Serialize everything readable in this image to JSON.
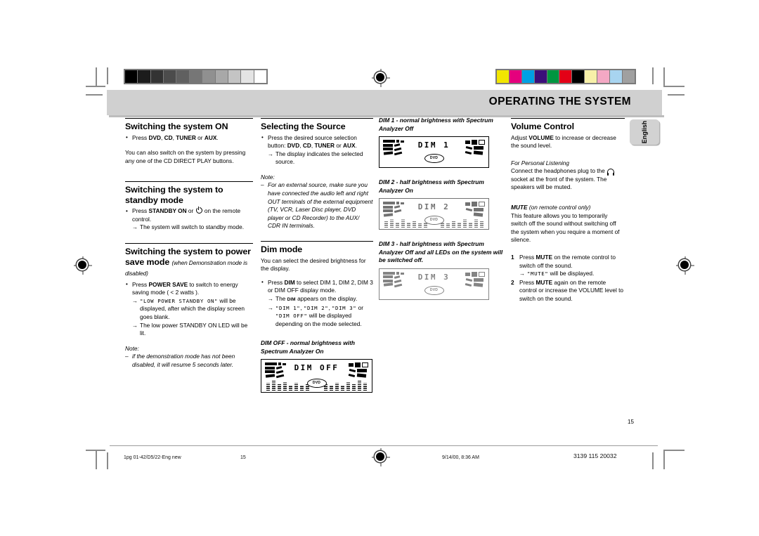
{
  "header": {
    "title": "OPERATING THE SYSTEM",
    "lang_tab": "English"
  },
  "calibration": {
    "gray_bar": [
      "#000000",
      "#1c1c1c",
      "#333333",
      "#4c4c4c",
      "#606060",
      "#767676",
      "#909090",
      "#a8a8a8",
      "#c4c4c4",
      "#e4e4e4",
      "#ffffff"
    ],
    "color_bar": [
      "#f2e600",
      "#e5007d",
      "#00a0e4",
      "#3b0f7a",
      "#009640",
      "#e30016",
      "#000000",
      "#f7f0a8",
      "#f4a8c4",
      "#a8d4f0",
      "#a0a0a0"
    ]
  },
  "col1": {
    "s1_title": "Switching the system ON",
    "s1_bullet": "Press DVD, CD, TUNER or AUX.",
    "s1_bullet_parts": {
      "pre": "Press ",
      "b1": "DVD",
      "sep1": ", ",
      "b2": "CD",
      "sep2": ", ",
      "b3": "TUNER",
      "sep3": " or ",
      "b4": "AUX",
      "post": "."
    },
    "s1_para": "You can also switch on the system by pressing any one of the CD DIRECT PLAY buttons.",
    "s2_title": "Switching the system to standby mode",
    "s2_bullet_pre": "Press ",
    "s2_bullet_b": "STANDBY ON",
    "s2_bullet_mid": " or ",
    "s2_bullet_post": " on the remote control.",
    "s2_arrow": "The system will switch to standby mode.",
    "s3_title_main": "Switching the system to power save mode",
    "s3_title_italic": "(when Demonstration mode is disabled)",
    "s3_bullet_pre": "Press ",
    "s3_bullet_b": "POWER SAVE",
    "s3_bullet_post": " to switch to energy saving mode ( < 2 watts ).",
    "s3_arrow1_lcd": "\"LOW POWER STANDBY ON\"",
    "s3_arrow1_rest": " will be displayed, after which the display screen goes blank.",
    "s3_arrow2": "The low power STANDBY ON LED will be lit.",
    "note_label": "Note:",
    "note_text": "if the demonstration mode has not been disabled, it will resume 5 seconds later."
  },
  "col2": {
    "s1_title": "Selecting the Source",
    "s1_bullet_pre": "Press the desired source selection button: ",
    "s1_b1": "DVD",
    "s1_sep1": ", ",
    "s1_b2": "CD",
    "s1_sep2": ", ",
    "s1_b3": "TUNER",
    "s1_sep3": " or ",
    "s1_b4": "AUX",
    "s1_post": ".",
    "s1_arrow": "The display indicates the selected source.",
    "note_label": "Note:",
    "note_text": "For an external source, make sure you have connected the audio left and right OUT terminals of the external equipment (TV, VCR, Laser Disc player, DVD player or CD Recorder) to the AUX/ CDR IN terminals.",
    "s2_title": "Dim mode",
    "s2_para": "You can select the desired brightness for the display.",
    "s2_bullet_pre": "Press ",
    "s2_bullet_b": "DIM",
    "s2_bullet_post": " to select DIM 1, DIM 2, DIM 3 or DIM OFF display mode.",
    "s2_arrow1_pre": "The ",
    "s2_arrow1_caps": "DIM",
    "s2_arrow1_post": " appears on the display.",
    "s2_arrow2_lcd1": "\"DIM 1\"",
    "s2_arrow2_c1": ", ",
    "s2_arrow2_lcd2": "\"DIM 2\"",
    "s2_arrow2_c2": ", ",
    "s2_arrow2_lcd3": "\"DIM 3\"",
    "s2_arrow2_or": " or ",
    "s2_arrow2_lcd4": "\"DIM OFF\"",
    "s2_arrow2_rest": " will be displayed depending on the mode selected.",
    "caption_dimoff": "DIM OFF - normal brightness with Spectrum Analyzer On",
    "lcd_dimoff_text": "DIM OFF"
  },
  "col3": {
    "caption_dim1": "DIM 1 - normal brightness with Spectrum Analyzer Off",
    "lcd_dim1_text": "DIM 1",
    "caption_dim2": "DIM 2 - half brightness with Spectrum Analyzer On",
    "lcd_dim2_text": "DIM 2",
    "caption_dim3": "DIM 3 - half brightness with Spectrum Analyzer Off and all LEDs on the system will be switched off.",
    "lcd_dim3_text": "DIM 3"
  },
  "col4": {
    "s1_title": "Volume Control",
    "s1_para_pre": "Adjust ",
    "s1_para_b": "VOLUME",
    "s1_para_post": " to increase or decrease the sound level.",
    "s2_label": "For Personal Listening",
    "s2_para_pre": "Connect the headphones plug to the ",
    "s2_para_post": " socket at the front of the system. The speakers will be muted.",
    "s3_label_b": "MUTE",
    "s3_label_i": " (on remote control only)",
    "s3_para": "This feature allows you to temporarily switch off the sound without switching off the system when you require a moment of silence.",
    "step1_num": "1",
    "step1_pre": "Press ",
    "step1_b": "MUTE",
    "step1_post": " on the remote control to switch off the sound.",
    "step1_arrow_lcd": "\"MUTE\"",
    "step1_arrow_rest": " will be displayed.",
    "step2_num": "2",
    "step2_pre": "Press ",
    "step2_b": "MUTE",
    "step2_post": " again on the remote control or increase the VOLUME level to switch on the sound."
  },
  "page": {
    "number": "15"
  },
  "footer": {
    "file": "1pg 01-42/D5/22-Eng new",
    "page": "15",
    "date": "9/14/00, 8:36 AM",
    "code": "3139 115 20032"
  }
}
